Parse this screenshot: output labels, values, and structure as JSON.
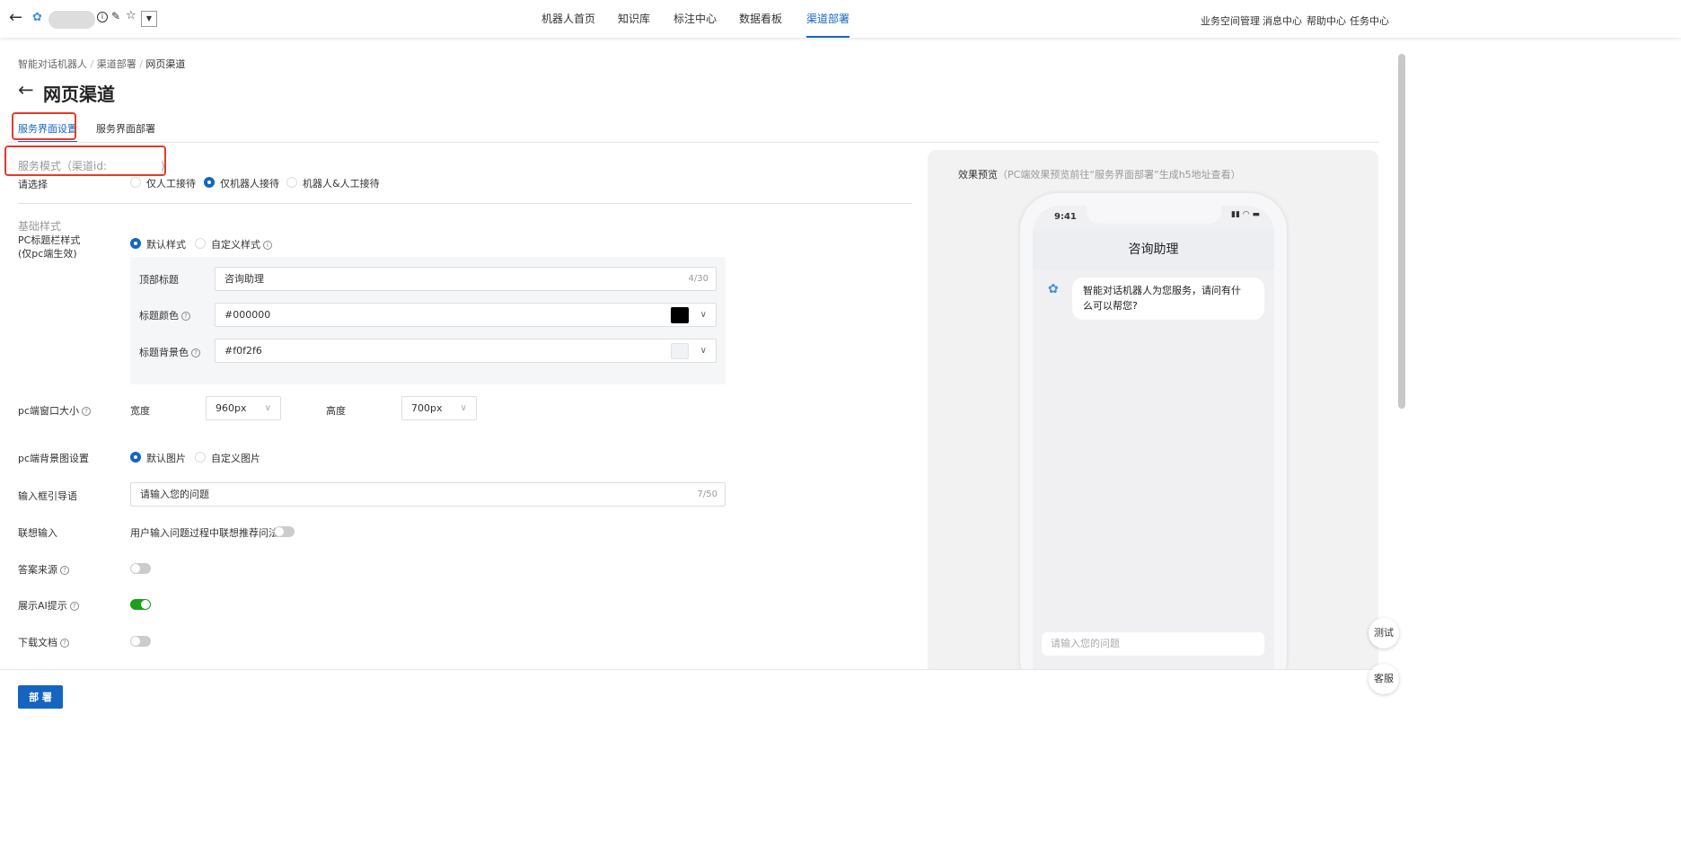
{
  "topbar": {
    "nav": [
      "机器人首页",
      "知识库",
      "标注中心",
      "数据看板",
      "渠道部署"
    ],
    "active": "渠道部署",
    "right": [
      "业务空间管理",
      "消息中心",
      "帮助中心",
      "任务中心"
    ]
  },
  "breadcrumb": [
    "智能对话机器人",
    "渠道部署",
    "网页渠道"
  ],
  "title": "网页渠道",
  "tabs": [
    "服务界面设置",
    "服务界面部署"
  ],
  "service_mode": {
    "label": "服务模式（渠道id:",
    "close": ")",
    "select_label": "请选择",
    "options": [
      "仅人工接待",
      "仅机器人接待",
      "机器人&人工接待"
    ],
    "selected": "仅机器人接待"
  },
  "basic_style": "基础样式",
  "pc_title": {
    "label1": "PC标题栏样式",
    "label2": "(仅pc端生效)",
    "options": [
      "默认样式",
      "自定义样式"
    ],
    "selected": "默认样式",
    "top_title_label": "顶部标题",
    "top_title_value": "咨询助理",
    "top_title_count": "4/30",
    "title_color_label": "标题颜色",
    "title_color_value": "#000000",
    "bg_color_label": "标题背景色",
    "bg_color_value": "#f0f2f6"
  },
  "window": {
    "label": "pc端窗口大小",
    "width_label": "宽度",
    "width_value": "960px",
    "height_label": "高度",
    "height_value": "700px"
  },
  "bg_image": {
    "label": "pc端背景图设置",
    "options": [
      "默认图片",
      "自定义图片"
    ],
    "selected": "默认图片"
  },
  "placeholder": {
    "label": "输入框引导语",
    "value": "请输入您的问题",
    "count": "7/50"
  },
  "suggest": {
    "label": "联想输入",
    "desc": "用户输入问题过程中联想推荐问法",
    "on": false
  },
  "answer_source": {
    "label": "答案来源",
    "on": false
  },
  "ai_hint": {
    "label": "展示AI提示",
    "on": true
  },
  "download": {
    "label": "下载文档",
    "on": false
  },
  "deploy_button": "部 署",
  "preview": {
    "title": "效果预览",
    "hint": "（PC端效果预览前往“服务界面部署”生成h5地址查看）",
    "time": "9:41",
    "header": "咨询助理",
    "greeting1": "智能对话机器人为您服务，请问有什",
    "greeting2": "么可以帮您?",
    "input_placeholder": "请输入您的问题"
  },
  "fab": [
    "测试",
    "客服"
  ],
  "colors": {
    "accent": "#1565c0",
    "toggle_on": "#1aa01a",
    "highlight": "#e53a2a"
  }
}
